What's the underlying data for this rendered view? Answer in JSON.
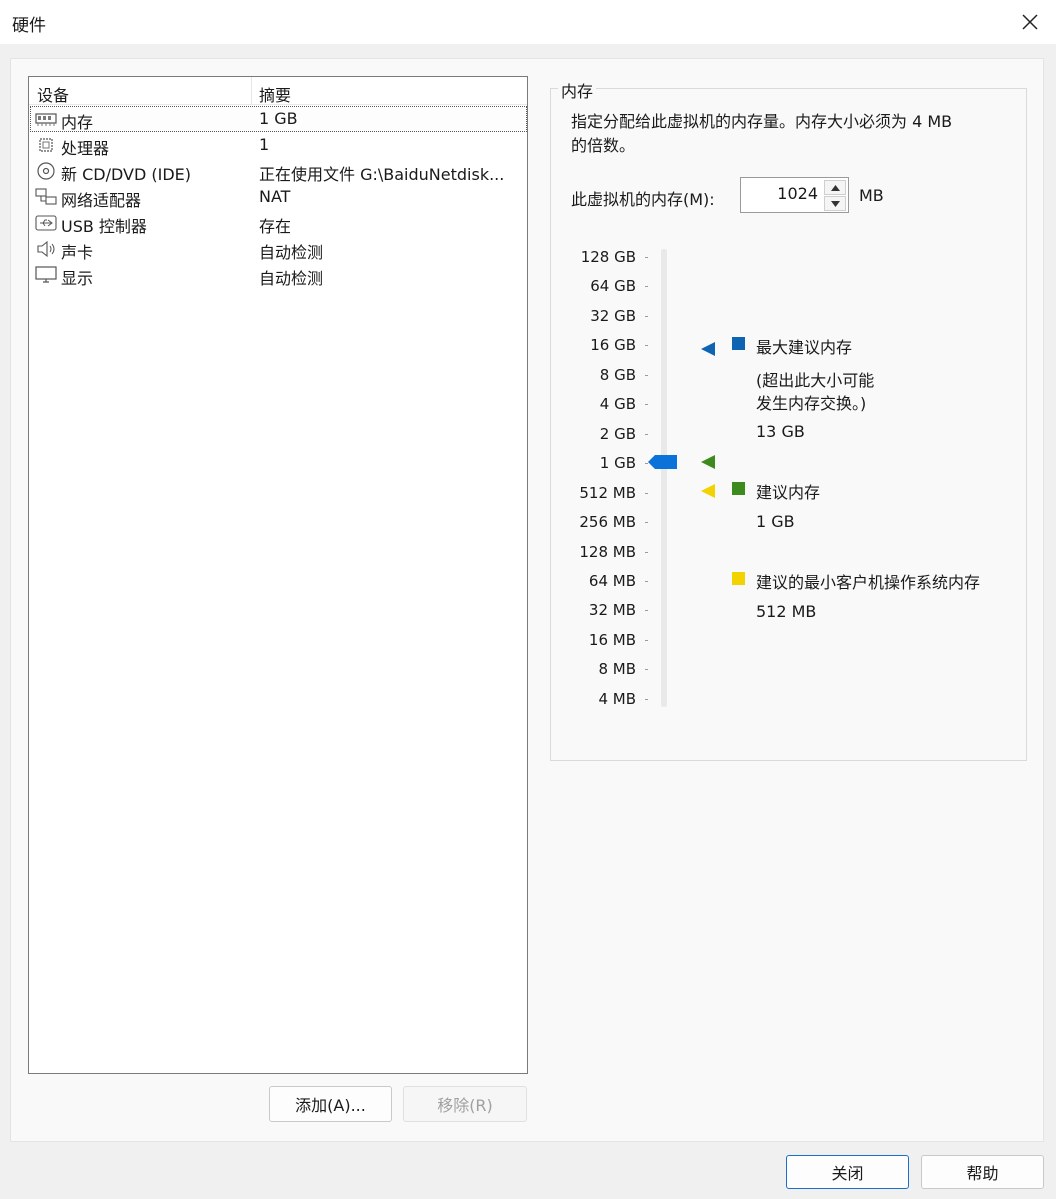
{
  "window": {
    "title": "硬件"
  },
  "device_list": {
    "col_device": "设备",
    "col_summary": "摘要",
    "rows": [
      {
        "name": "内存",
        "summary": "1 GB",
        "icon": "memory-icon"
      },
      {
        "name": "处理器",
        "summary": "1",
        "icon": "processor-icon"
      },
      {
        "name": "新 CD/DVD (IDE)",
        "summary": "正在使用文件 G:\\BaiduNetdisk...",
        "icon": "cd-dvd-icon"
      },
      {
        "name": "网络适配器",
        "summary": "NAT",
        "icon": "network-icon"
      },
      {
        "name": "USB 控制器",
        "summary": "存在",
        "icon": "usb-icon"
      },
      {
        "name": "声卡",
        "summary": "自动检测",
        "icon": "speaker-icon"
      },
      {
        "name": "显示",
        "summary": "自动检测",
        "icon": "monitor-icon"
      }
    ],
    "selected_index": 0
  },
  "buttons": {
    "add": "添加(A)...",
    "remove": "移除(R)",
    "close": "关闭",
    "help": "帮助"
  },
  "memory": {
    "group_title": "内存",
    "description_line1": "指定分配给此虚拟机的内存量。内存大小必须为 4 MB",
    "description_line2": "的倍数。",
    "field_label": "此虚拟机的内存(M):",
    "value": "1024",
    "unit": "MB",
    "scale_labels": [
      "128 GB",
      "64 GB",
      "32 GB",
      "16 GB",
      "8 GB",
      "4 GB",
      "2 GB",
      "1 GB",
      "512 MB",
      "256 MB",
      "128 MB",
      "64 MB",
      "32 MB",
      "16 MB",
      "8 MB",
      "4 MB"
    ],
    "current_level": "1 GB",
    "legend": {
      "max_title": "最大建议内存",
      "max_note_line1": "(超出此大小可能",
      "max_note_line2": "发生内存交换。)",
      "max_value": "13 GB",
      "rec_title": "建议内存",
      "rec_value": "1 GB",
      "min_title": "建议的最小客户机操作系统内存",
      "min_value": "512 MB"
    },
    "colors": {
      "max": "#0f63b3",
      "recommended": "#3d8b1e",
      "minimum": "#f2d200",
      "slider_thumb": "#0a72d8"
    }
  }
}
